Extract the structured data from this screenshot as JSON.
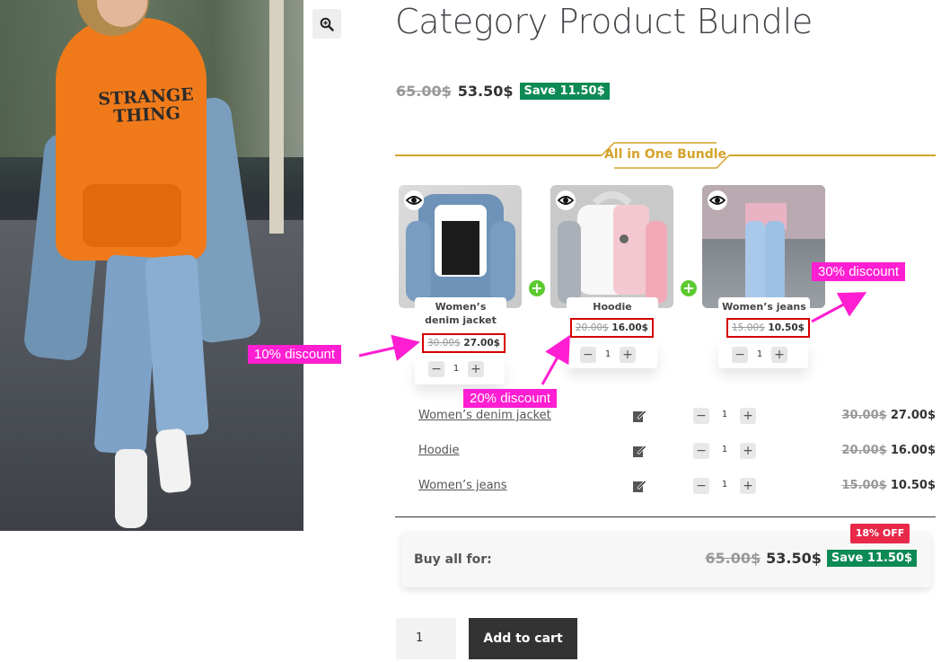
{
  "product": {
    "title": "Category Product Bundle",
    "price_old": "65.00$",
    "price_new": "53.50$",
    "save_badge": "Save 11.50$",
    "hero_hoodie_text": "STRANGE THING"
  },
  "bundle": {
    "title": "All in One Bundle",
    "accent_color": "#d4a32a",
    "items": [
      {
        "name": "Women’s denim jacket",
        "price_old": "30.00$",
        "price_new": "27.00$",
        "qty": "1",
        "callout": "10% discount"
      },
      {
        "name": "Hoodie",
        "price_old": "20.00$",
        "price_new": "16.00$",
        "qty": "1",
        "callout": "20% discount"
      },
      {
        "name": "Women’s jeans",
        "price_old": "15.00$",
        "price_new": "10.50$",
        "qty": "1",
        "callout": "30% discount"
      }
    ]
  },
  "summary": {
    "buy_all_label": "Buy all for:",
    "price_old": "65.00$",
    "price_new": "53.50$",
    "save_badge": "Save 11.50$",
    "off_ribbon": "18% OFF"
  },
  "cart": {
    "quantity": "1",
    "add_to_cart_label": "Add to cart"
  },
  "colors": {
    "save_badge": "#0e8a55",
    "callout": "#ff1ed2",
    "ribbon": "#e8294a",
    "plus_separator": "#5cc930"
  }
}
